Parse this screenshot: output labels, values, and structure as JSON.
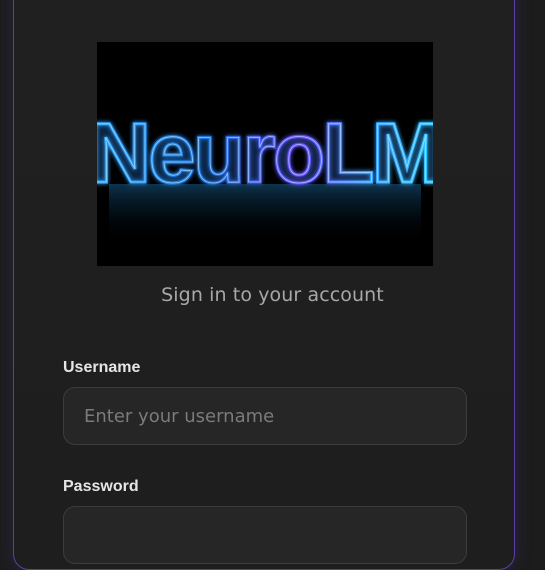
{
  "logo": {
    "wordmark": "NeuroLM",
    "colors": {
      "background": "#000000",
      "glow": "#2fb4ff",
      "accent": "#7a5cff"
    }
  },
  "subtitle": "Sign in to your account",
  "form": {
    "username": {
      "label": "Username",
      "placeholder": "Enter your username",
      "value": ""
    },
    "password": {
      "label": "Password",
      "placeholder": "",
      "value": ""
    }
  },
  "theme": {
    "card_border": "#5b3fa8",
    "background": "#1c1c1c"
  }
}
